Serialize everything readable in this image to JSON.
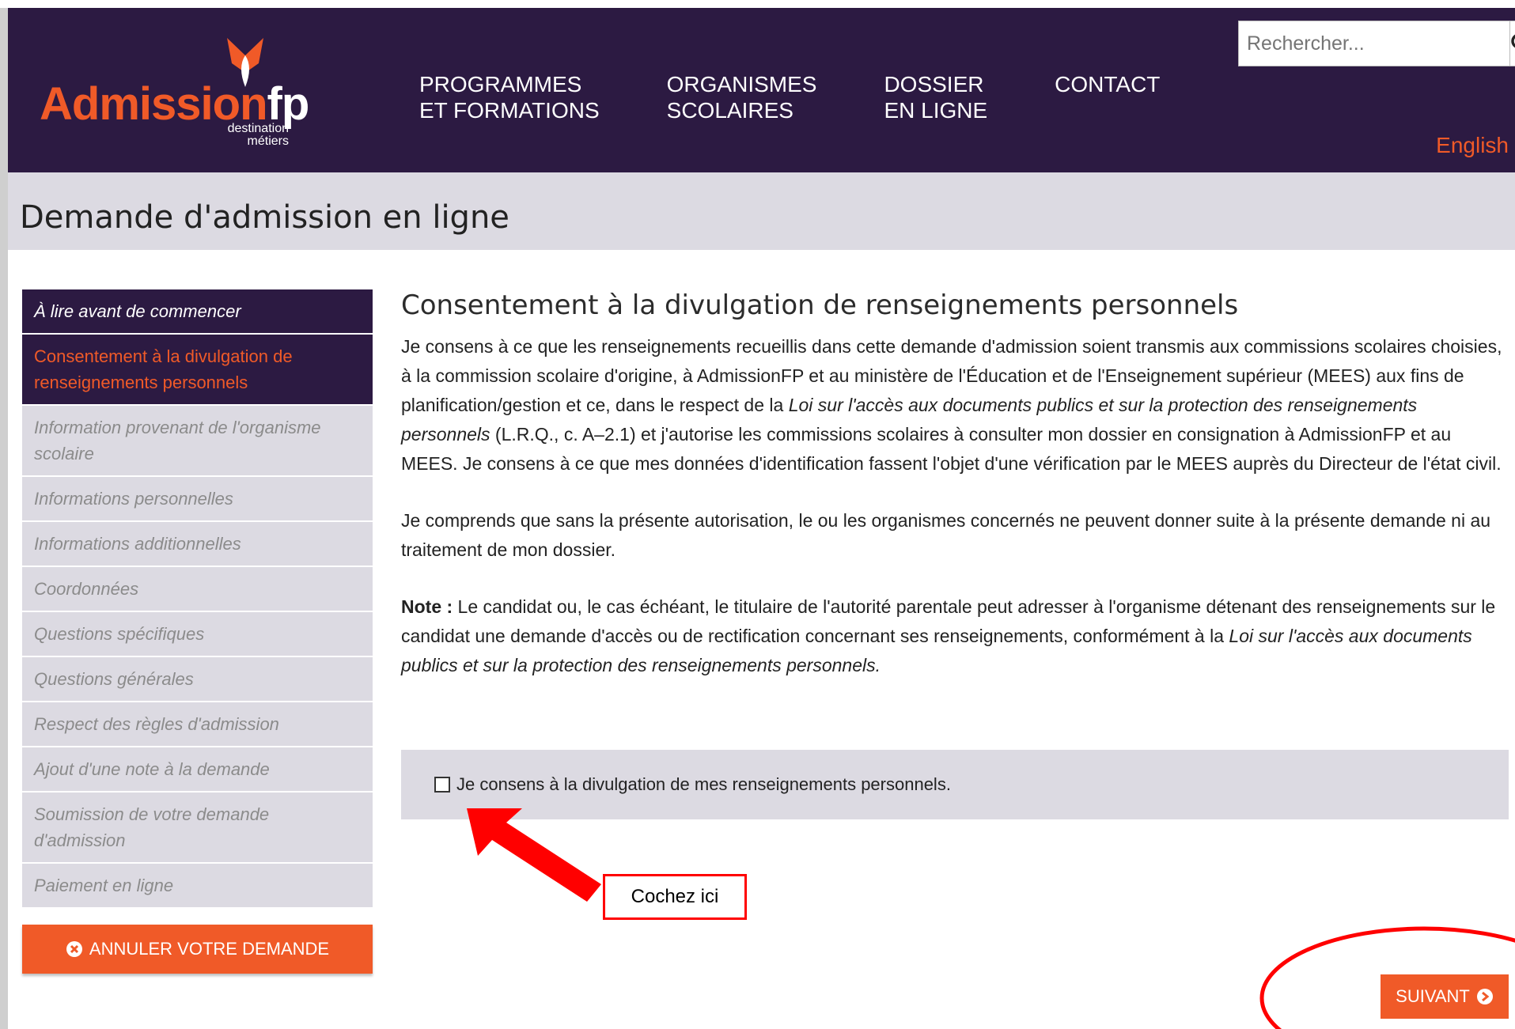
{
  "header": {
    "logo_text_1": "Admissio",
    "logo_text_n": "n",
    "logo_text_2": "fp",
    "logo_sub_1": "destination",
    "logo_sub_2": "métiers",
    "nav": [
      {
        "line1": "PROGRAMMES",
        "line2": "ET FORMATIONS"
      },
      {
        "line1": "ORGANISMES",
        "line2": "SCOLAIRES"
      },
      {
        "line1": "DOSSIER",
        "line2": "EN LIGNE"
      },
      {
        "line1": "CONTACT",
        "line2": ""
      }
    ],
    "search_placeholder": "Rechercher...",
    "lang": "English"
  },
  "page_title": "Demande d'admission en ligne",
  "sidebar": {
    "items": [
      {
        "label": "À lire avant de commencer"
      },
      {
        "label": "Consentement à la divulgation de renseignements personnels"
      },
      {
        "label": "Information provenant de l'organisme scolaire"
      },
      {
        "label": "Informations personnelles"
      },
      {
        "label": "Informations additionnelles"
      },
      {
        "label": "Coordonnées"
      },
      {
        "label": "Questions spécifiques"
      },
      {
        "label": "Questions générales"
      },
      {
        "label": "Respect des règles d'admission"
      },
      {
        "label": "Ajout d'une note à la demande"
      },
      {
        "label": "Soumission de votre demande d'admission"
      },
      {
        "label": "Paiement en ligne"
      }
    ],
    "cancel_label": "ANNULER VOTRE DEMANDE"
  },
  "main": {
    "heading": "Consentement à la divulgation de renseignements personnels",
    "p1_a": "Je consens à ce que les renseignements recueillis dans cette demande d'admission soient transmis aux commissions scolaires choisies, à la commission scolaire d'origine, à AdmissionFP et au ministère de l'Éducation et de l'Enseignement supérieur (MEES) aux fins de planification/gestion et ce, dans le respect de la ",
    "p1_law": "Loi sur l'accès aux documents publics et sur la protection des renseignements personnels",
    "p1_b": " (L.R.Q., c. A–2.1) et j'autorise les commissions scolaires à consulter mon dossier en consignation à AdmissionFP et au MEES. Je consens à ce que mes données d'identification fassent l'objet d'une vérification par le MEES auprès du Directeur de l'état civil.",
    "p2": "Je comprends que sans la présente autorisation, le ou les organismes concernés ne peuvent donner suite à la présente demande ni au traitement de mon dossier.",
    "note_label": "Note :",
    "note_text": " Le candidat ou, le cas échéant, le titulaire de l'autorité parentale peut adresser à l'organisme détenant des renseignements sur le candidat une demande d'accès ou de rectification concernant ses renseignements, conformément à la ",
    "note_law": "Loi sur l'accès aux documents publics et sur la protection des renseignements personnels.",
    "consent_label": "Je consens à la divulgation de mes renseignements personnels.",
    "next_label": "SUIVANT"
  },
  "annotation": {
    "text": "Cochez ici"
  },
  "colors": {
    "brand_dark": "#2c1a42",
    "brand_orange": "#f05a28",
    "sidebar_bg": "#dcdae2",
    "annotation_red": "#ff0000"
  }
}
